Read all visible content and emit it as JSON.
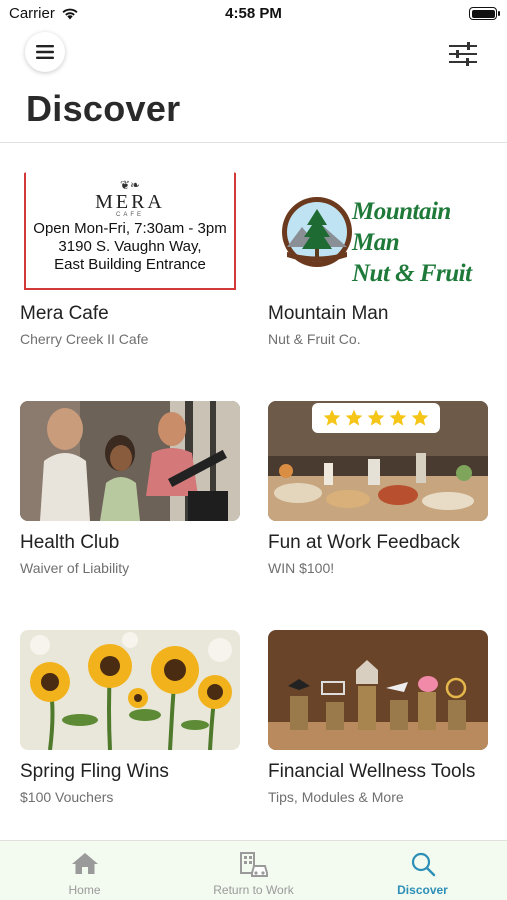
{
  "status_bar": {
    "carrier": "Carrier",
    "time": "4:58 PM",
    "wifi_icon": "wifi-icon",
    "battery_icon": "battery-icon"
  },
  "header": {
    "menu_icon": "hamburger-menu-icon",
    "filter_icon": "sliders-filter-icon",
    "title": "Discover"
  },
  "cards": [
    {
      "title": "Mera Cafe",
      "subtitle": "Cherry Creek II Cafe",
      "image": {
        "name": "MERA",
        "sub": "CAFE",
        "lines": [
          "Open Mon-Fri, 7:30am - 3pm",
          "3190 S. Vaughn Way,",
          "East Building Entrance"
        ]
      }
    },
    {
      "title": "Mountain Man",
      "subtitle": "Nut & Fruit Co.",
      "image": {
        "logo_line1": "Mountain Man",
        "logo_line2": "Nut & Fruit Co.",
        "registered": "®"
      }
    },
    {
      "title": "Health Club",
      "subtitle": "Waiver of Liability"
    },
    {
      "title": "Fun at Work Feedback",
      "subtitle": "WIN $100!",
      "image": {
        "rating": 5,
        "max_rating": 5
      }
    },
    {
      "title": "Spring Fling Wins",
      "subtitle": "$100 Vouchers"
    },
    {
      "title": "Financial Wellness Tools",
      "subtitle": "Tips, Modules & More"
    }
  ],
  "tab_bar": {
    "tabs": [
      {
        "label": "Home",
        "icon": "home-icon",
        "active": false
      },
      {
        "label": "Return to Work",
        "icon": "building-car-icon",
        "active": false
      },
      {
        "label": "Discover",
        "icon": "search-icon",
        "active": true
      }
    ],
    "active_color": "#2c8fb7",
    "inactive_color": "#9a9a9a"
  },
  "colors": {
    "tab_bar_background": "#f3faf0",
    "mera_border": "#d23a3a",
    "mountain_man_green": "#1f7a3a"
  }
}
